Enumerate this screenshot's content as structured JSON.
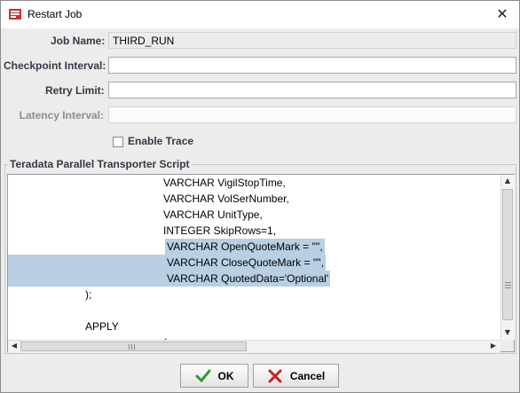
{
  "window": {
    "title": "Restart Job",
    "close_glyph": "✕"
  },
  "form": {
    "job_name_label": "Job Name:",
    "job_name_value": "THIRD_RUN",
    "checkpoint_label": "Checkpoint Interval:",
    "checkpoint_value": "",
    "retry_label": "Retry Limit:",
    "retry_value": "",
    "latency_label": "Latency Interval:",
    "latency_value": "",
    "trace_label": "Enable Trace",
    "trace_checked": false
  },
  "script": {
    "group_title": "Teradata Parallel Transporter Script",
    "lines": [
      "VARCHAR VigilStopTime,",
      "VARCHAR VolSerNumber,",
      "VARCHAR UnitType,",
      "INTEGER SkipRows=1,",
      "VARCHAR OpenQuoteMark = '\"',",
      "VARCHAR CloseQuoteMark = '\"',",
      "VARCHAR QuotedData='Optional'",
      ");",
      "",
      "APPLY",
      "("
    ],
    "selected_lines": [
      4,
      5,
      6
    ]
  },
  "buttons": {
    "ok_label": "OK",
    "cancel_label": "Cancel"
  },
  "colors": {
    "selection": "#b8cfe4",
    "ok_icon": "#2e9a2e",
    "cancel_icon": "#cc2020"
  },
  "icons": {
    "title": "restart-job-icon",
    "ok": "checkmark-icon",
    "cancel": "x-icon"
  }
}
